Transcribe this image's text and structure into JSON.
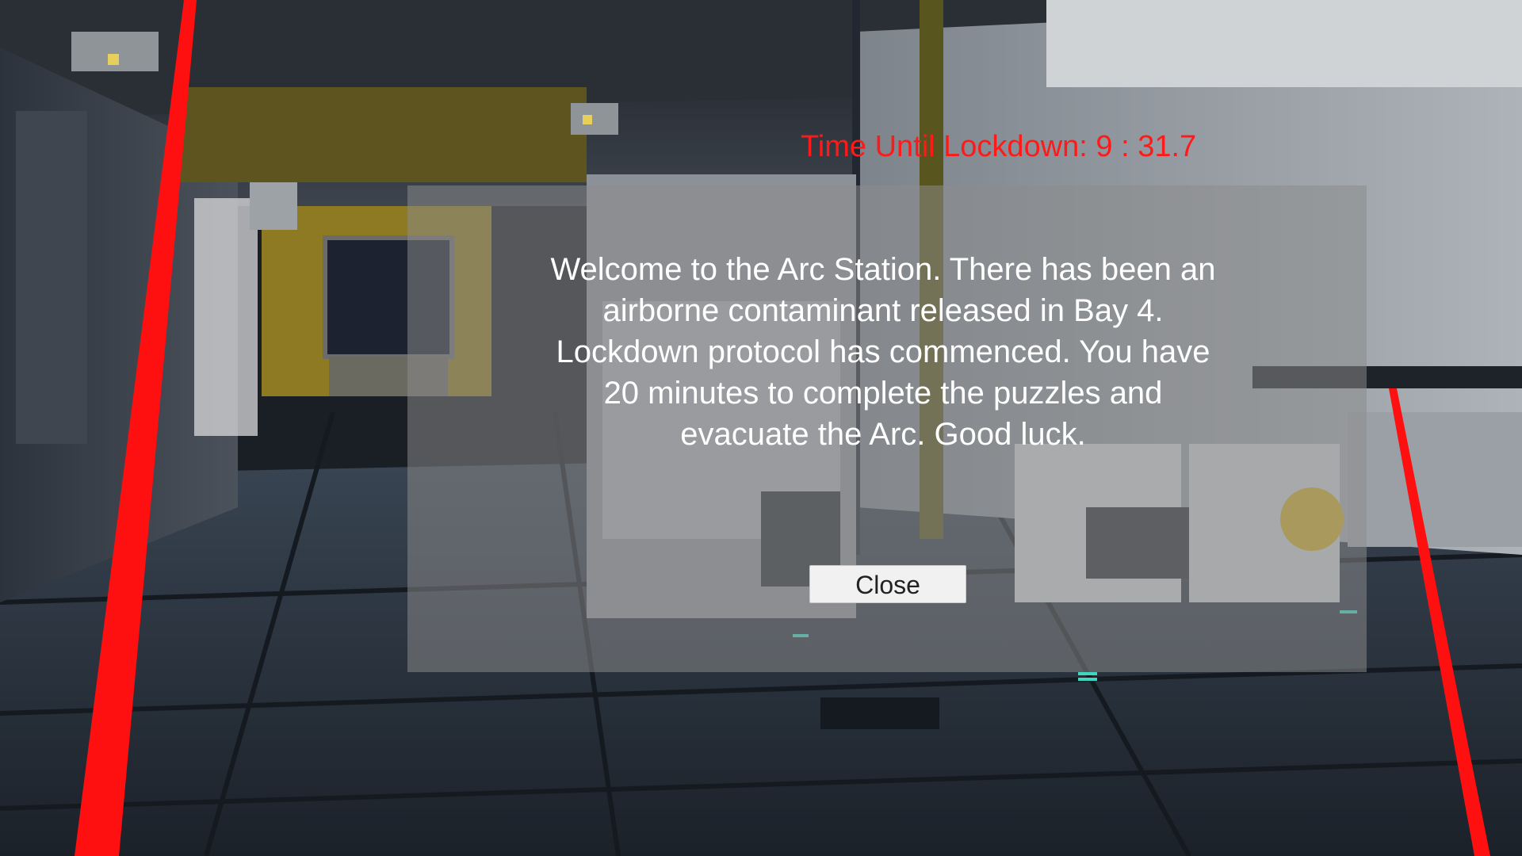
{
  "hud": {
    "timer_text": "Time Until Lockdown: 9 : 31.7",
    "timer_color": "#ff1a1a"
  },
  "dialog": {
    "message": "Welcome to the Arc Station. There has been an airborne contaminant released in Bay 4. Lockdown protocol has commenced. You have 20 minutes to complete the puzzles and evacuate the Arc. Good luck.",
    "close_label": "Close"
  },
  "scene": {
    "description_icon": "space-station-corridor",
    "accent_yellow": "#c9a82a",
    "laser_color": "#ff1010",
    "floor_light_color": "#3fd6c0"
  }
}
